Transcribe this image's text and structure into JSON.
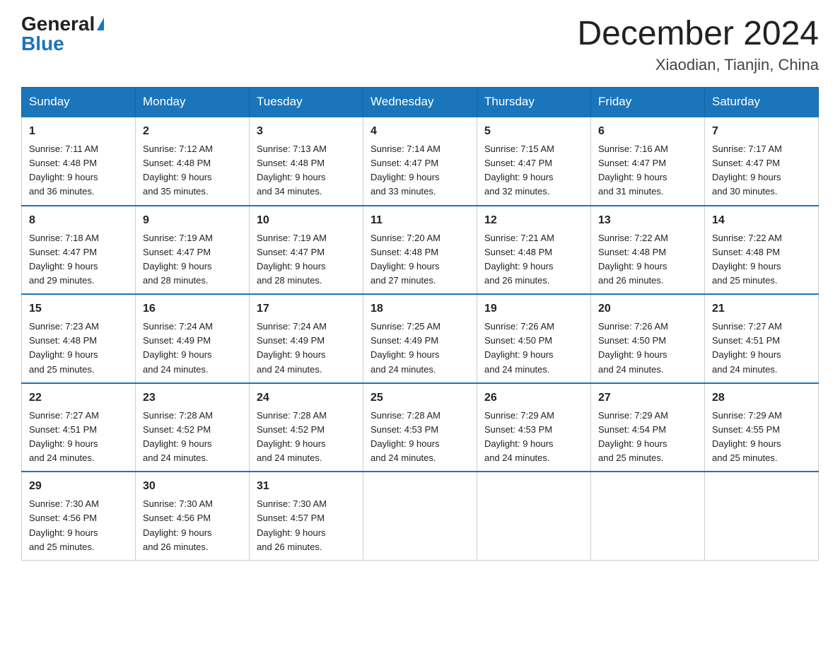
{
  "logo": {
    "general": "General",
    "blue": "Blue"
  },
  "header": {
    "month": "December 2024",
    "location": "Xiaodian, Tianjin, China"
  },
  "days_of_week": [
    "Sunday",
    "Monday",
    "Tuesday",
    "Wednesday",
    "Thursday",
    "Friday",
    "Saturday"
  ],
  "weeks": [
    [
      {
        "day": "1",
        "sunrise": "7:11 AM",
        "sunset": "4:48 PM",
        "daylight": "9 hours and 36 minutes."
      },
      {
        "day": "2",
        "sunrise": "7:12 AM",
        "sunset": "4:48 PM",
        "daylight": "9 hours and 35 minutes."
      },
      {
        "day": "3",
        "sunrise": "7:13 AM",
        "sunset": "4:48 PM",
        "daylight": "9 hours and 34 minutes."
      },
      {
        "day": "4",
        "sunrise": "7:14 AM",
        "sunset": "4:47 PM",
        "daylight": "9 hours and 33 minutes."
      },
      {
        "day": "5",
        "sunrise": "7:15 AM",
        "sunset": "4:47 PM",
        "daylight": "9 hours and 32 minutes."
      },
      {
        "day": "6",
        "sunrise": "7:16 AM",
        "sunset": "4:47 PM",
        "daylight": "9 hours and 31 minutes."
      },
      {
        "day": "7",
        "sunrise": "7:17 AM",
        "sunset": "4:47 PM",
        "daylight": "9 hours and 30 minutes."
      }
    ],
    [
      {
        "day": "8",
        "sunrise": "7:18 AM",
        "sunset": "4:47 PM",
        "daylight": "9 hours and 29 minutes."
      },
      {
        "day": "9",
        "sunrise": "7:19 AM",
        "sunset": "4:47 PM",
        "daylight": "9 hours and 28 minutes."
      },
      {
        "day": "10",
        "sunrise": "7:19 AM",
        "sunset": "4:47 PM",
        "daylight": "9 hours and 28 minutes."
      },
      {
        "day": "11",
        "sunrise": "7:20 AM",
        "sunset": "4:48 PM",
        "daylight": "9 hours and 27 minutes."
      },
      {
        "day": "12",
        "sunrise": "7:21 AM",
        "sunset": "4:48 PM",
        "daylight": "9 hours and 26 minutes."
      },
      {
        "day": "13",
        "sunrise": "7:22 AM",
        "sunset": "4:48 PM",
        "daylight": "9 hours and 26 minutes."
      },
      {
        "day": "14",
        "sunrise": "7:22 AM",
        "sunset": "4:48 PM",
        "daylight": "9 hours and 25 minutes."
      }
    ],
    [
      {
        "day": "15",
        "sunrise": "7:23 AM",
        "sunset": "4:48 PM",
        "daylight": "9 hours and 25 minutes."
      },
      {
        "day": "16",
        "sunrise": "7:24 AM",
        "sunset": "4:49 PM",
        "daylight": "9 hours and 24 minutes."
      },
      {
        "day": "17",
        "sunrise": "7:24 AM",
        "sunset": "4:49 PM",
        "daylight": "9 hours and 24 minutes."
      },
      {
        "day": "18",
        "sunrise": "7:25 AM",
        "sunset": "4:49 PM",
        "daylight": "9 hours and 24 minutes."
      },
      {
        "day": "19",
        "sunrise": "7:26 AM",
        "sunset": "4:50 PM",
        "daylight": "9 hours and 24 minutes."
      },
      {
        "day": "20",
        "sunrise": "7:26 AM",
        "sunset": "4:50 PM",
        "daylight": "9 hours and 24 minutes."
      },
      {
        "day": "21",
        "sunrise": "7:27 AM",
        "sunset": "4:51 PM",
        "daylight": "9 hours and 24 minutes."
      }
    ],
    [
      {
        "day": "22",
        "sunrise": "7:27 AM",
        "sunset": "4:51 PM",
        "daylight": "9 hours and 24 minutes."
      },
      {
        "day": "23",
        "sunrise": "7:28 AM",
        "sunset": "4:52 PM",
        "daylight": "9 hours and 24 minutes."
      },
      {
        "day": "24",
        "sunrise": "7:28 AM",
        "sunset": "4:52 PM",
        "daylight": "9 hours and 24 minutes."
      },
      {
        "day": "25",
        "sunrise": "7:28 AM",
        "sunset": "4:53 PM",
        "daylight": "9 hours and 24 minutes."
      },
      {
        "day": "26",
        "sunrise": "7:29 AM",
        "sunset": "4:53 PM",
        "daylight": "9 hours and 24 minutes."
      },
      {
        "day": "27",
        "sunrise": "7:29 AM",
        "sunset": "4:54 PM",
        "daylight": "9 hours and 25 minutes."
      },
      {
        "day": "28",
        "sunrise": "7:29 AM",
        "sunset": "4:55 PM",
        "daylight": "9 hours and 25 minutes."
      }
    ],
    [
      {
        "day": "29",
        "sunrise": "7:30 AM",
        "sunset": "4:56 PM",
        "daylight": "9 hours and 25 minutes."
      },
      {
        "day": "30",
        "sunrise": "7:30 AM",
        "sunset": "4:56 PM",
        "daylight": "9 hours and 26 minutes."
      },
      {
        "day": "31",
        "sunrise": "7:30 AM",
        "sunset": "4:57 PM",
        "daylight": "9 hours and 26 minutes."
      },
      null,
      null,
      null,
      null
    ]
  ],
  "labels": {
    "sunrise": "Sunrise:",
    "sunset": "Sunset:",
    "daylight": "Daylight:"
  }
}
